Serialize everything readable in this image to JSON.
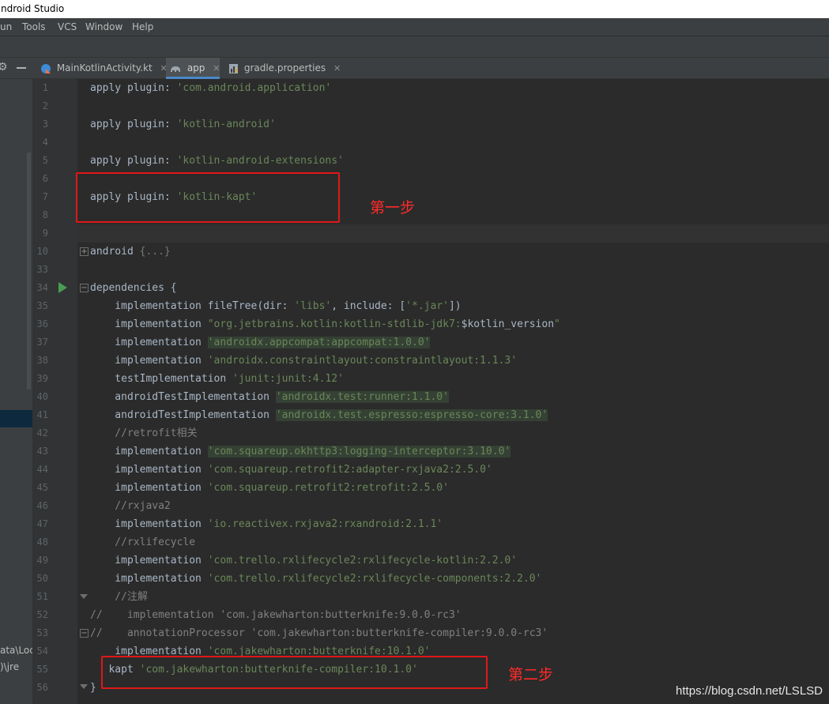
{
  "window": {
    "title": "ndroid Studio"
  },
  "menu": {
    "items": [
      "un",
      "Tools",
      "VCS",
      "Window",
      "Help"
    ]
  },
  "left_panel": {
    "texts": [
      "ata\\Loca",
      ")\\jre"
    ]
  },
  "tabs": [
    {
      "label": "MainKotlinActivity.kt",
      "active": false,
      "icon": "kotlin-file-icon"
    },
    {
      "label": "app",
      "active": true,
      "icon": "gradle-elephant-icon"
    },
    {
      "label": "gradle.properties",
      "active": false,
      "icon": "properties-file-icon"
    }
  ],
  "line_numbers": [
    "1",
    "2",
    "3",
    "4",
    "5",
    "6",
    "7",
    "8",
    "9",
    "10",
    "33",
    "34",
    "35",
    "36",
    "37",
    "38",
    "39",
    "40",
    "41",
    "42",
    "43",
    "44",
    "45",
    "46",
    "47",
    "48",
    "49",
    "50",
    "51",
    "52",
    "53",
    "54",
    "55",
    "56"
  ],
  "code_lines": [
    [
      {
        "t": "apply plugin: "
      },
      {
        "t": "'com.android.application'",
        "c": "str"
      }
    ],
    [],
    [
      {
        "t": "apply plugin: "
      },
      {
        "t": "'kotlin-android'",
        "c": "str"
      }
    ],
    [],
    [
      {
        "t": "apply plugin: "
      },
      {
        "t": "'kotlin-android-extensions'",
        "c": "str"
      }
    ],
    [],
    [
      {
        "t": "apply plugin: "
      },
      {
        "t": "'kotlin-kapt'",
        "c": "str"
      }
    ],
    [],
    [],
    [
      {
        "t": "android "
      },
      {
        "t": "{...}",
        "c": "fold"
      }
    ],
    [],
    [
      {
        "t": "dependencies {"
      }
    ],
    [
      {
        "t": "    implementation fileTree(dir: "
      },
      {
        "t": "'libs'",
        "c": "str"
      },
      {
        "t": ", include: ["
      },
      {
        "t": "'*.jar'",
        "c": "str"
      },
      {
        "t": "])"
      }
    ],
    [
      {
        "t": "    implementation "
      },
      {
        "t": "\"org.jetbrains.kotlin:kotlin-stdlib-jdk7:",
        "c": "str"
      },
      {
        "t": "$kotlin_version"
      },
      {
        "t": "\"",
        "c": "str"
      }
    ],
    [
      {
        "t": "    implementation "
      },
      {
        "t": "'androidx.appcompat:appcompat:1.0.0'",
        "c": "str hl"
      }
    ],
    [
      {
        "t": "    implementation "
      },
      {
        "t": "'androidx.constraintlayout:constraintlayout:1.1.3'",
        "c": "str"
      }
    ],
    [
      {
        "t": "    testImplementation "
      },
      {
        "t": "'junit:junit:4.12'",
        "c": "str"
      }
    ],
    [
      {
        "t": "    androidTestImplementation "
      },
      {
        "t": "'androidx.test:runner:1.1.0'",
        "c": "str hl"
      }
    ],
    [
      {
        "t": "    androidTestImplementation "
      },
      {
        "t": "'androidx.test.espresso:espresso-core:3.1.0'",
        "c": "str hl"
      }
    ],
    [
      {
        "t": "    //retrofit相关",
        "c": "cmt"
      }
    ],
    [
      {
        "t": "    implementation "
      },
      {
        "t": "'com.squareup.okhttp3:logging-interceptor:3.10.0'",
        "c": "str hl"
      }
    ],
    [
      {
        "t": "    implementation "
      },
      {
        "t": "'com.squareup.retrofit2:adapter-rxjava2:2.5.0'",
        "c": "str"
      }
    ],
    [
      {
        "t": "    implementation "
      },
      {
        "t": "'com.squareup.retrofit2:retrofit:2.5.0'",
        "c": "str"
      }
    ],
    [
      {
        "t": "    //rxjava2",
        "c": "cmt"
      }
    ],
    [
      {
        "t": "    implementation "
      },
      {
        "t": "'io.reactivex.rxjava2:rxandroid:2.1.1'",
        "c": "str"
      }
    ],
    [
      {
        "t": "    //rxlifecycle",
        "c": "cmt"
      }
    ],
    [
      {
        "t": "    implementation "
      },
      {
        "t": "'com.trello.rxlifecycle2:rxlifecycle-kotlin:2.2.0'",
        "c": "str"
      }
    ],
    [
      {
        "t": "    implementation "
      },
      {
        "t": "'com.trello.rxlifecycle2:rxlifecycle-components:2.2.0'",
        "c": "str"
      }
    ],
    [
      {
        "t": "    //注解",
        "c": "cmt"
      }
    ],
    [
      {
        "t": "//    implementation 'com.jakewharton:butterknife:9.0.0-rc3'",
        "c": "cmt"
      }
    ],
    [
      {
        "t": "//    annotationProcessor 'com.jakewharton:butterknife-compiler:9.0.0-rc3'",
        "c": "cmt"
      }
    ],
    [
      {
        "t": "    implementation "
      },
      {
        "t": "'com.jakewharton:butterknife:10.1.0'",
        "c": "str"
      }
    ],
    [
      {
        "t": "   kapt "
      },
      {
        "t": "'com.jakewharton:butterknife-compiler:10.1.0'",
        "c": "str"
      }
    ],
    [
      {
        "t": "}"
      }
    ]
  ],
  "annotations": {
    "step1": "第一步",
    "step2": "第二步"
  },
  "watermark": "https://blog.csdn.net/LSLSD",
  "colors": {
    "keyword": "#a9b7c6",
    "string": "#6a8759",
    "comment": "#808080",
    "annotation": "#ff2a2a",
    "active_tab_underline": "#4a88c7"
  }
}
